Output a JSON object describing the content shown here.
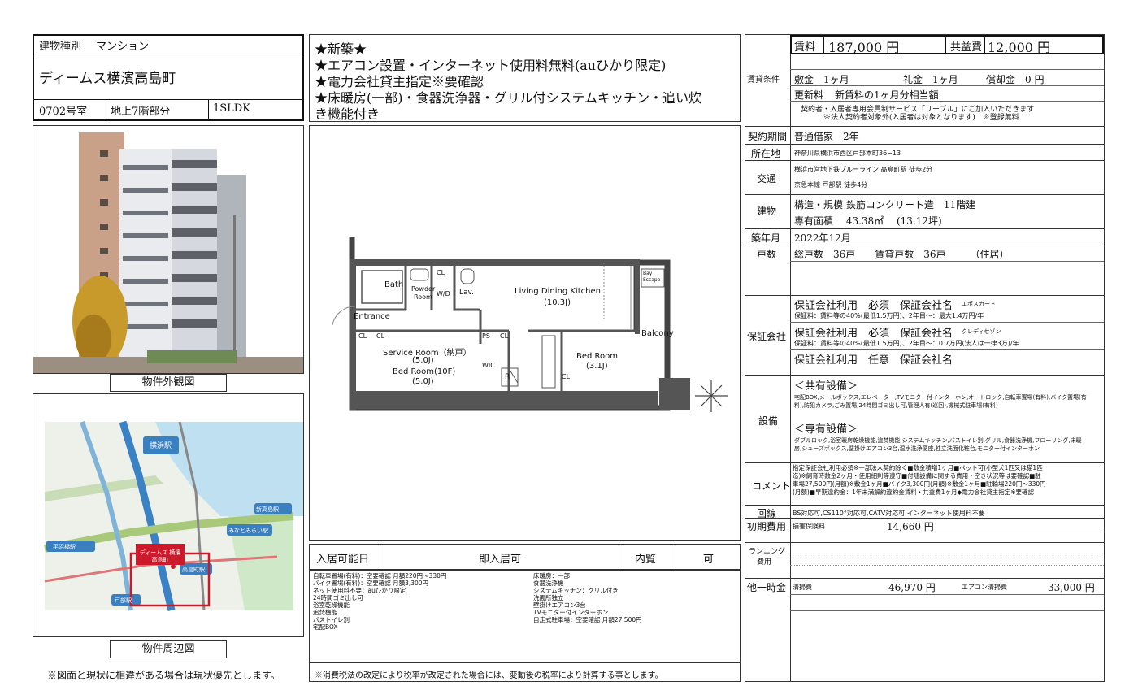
{
  "left": {
    "type_label": "建物種別",
    "type_value": "マンション",
    "building_name": "ディームス横濱高島町",
    "room": "0702号室",
    "floor": "地上7階部分",
    "layout": "1SLDK",
    "photo_caption": "物件外観図",
    "map_caption": "物件周辺図",
    "footnote": "※図面と現状に相違がある場合は現状優先とします。",
    "map_labels": {
      "yokohama": "横浜駅",
      "shintakashima": "新高島駅",
      "minatomirai": "みなとみらい駅",
      "takashimacho": "高島町駅",
      "tobe": "戸部駅",
      "hiranumabashi": "平沼橋駅",
      "property": "ディームス 横濱高島町"
    }
  },
  "headline": {
    "l1": "★新築★",
    "l2": "★エアコン設置・インターネット使用料無料(auひかり限定)",
    "l3": "★電力会社貸主指定※要確認",
    "l4": "★床暖房(一部)・食器洗浄器・グリル付システムキッチン・追い炊",
    "l5": "き機能付き"
  },
  "floorplan": {
    "bath": "Bath",
    "powder1": "Powder",
    "powder2": "Room",
    "wd": "W/D",
    "lav": "Lav.",
    "ldk1": "Living Dining Kitchen",
    "ldk2": "(10.3J)",
    "entrance": "Entrance",
    "service1": "Service Room（納戸）",
    "service2": "(5.0J)",
    "bed10f1": "Bed Room(10F)",
    "bed10f2": "(5.0J)",
    "wic": "WIC",
    "r": "R",
    "bed1": "Bed Room",
    "bed2": "(3.1J)",
    "balcony": "Balcony",
    "cl": "CL",
    "ps": "PS",
    "escape": "Bay Escape"
  },
  "availability": {
    "label": "入居可能日",
    "value": "即入居可",
    "view_label": "内覧",
    "view_value": "可"
  },
  "equipment_left": [
    "自転車置場(有料)：空要確認 月額220円〜330円",
    "バイク置場(有料)：空要確認 月額3,300円",
    "ネット使用料不要：auひかり限定",
    "24時間ゴミ出し可",
    "浴室乾燥機能",
    "追焚機能",
    "バストイレ別",
    "宅配BOX"
  ],
  "equipment_right": [
    "床暖房：一部",
    "食器洗浄機",
    "システムキッチン：グリル付き",
    "洗面所独立",
    "壁掛けエアコン3台",
    "TVモニター付インターホン",
    "自走式駐車場：空要確認 月額27,500円"
  ],
  "tax_note": "※消費税法の改定により税率が改定された場合には、変動後の税率により計算する事とします。",
  "right": {
    "rent_cond_label": "賃貸条件",
    "rent_label": "賃料",
    "rent_value": "187,000 円",
    "common_label": "共益費",
    "common_value": "12,000 円",
    "deposit": "敷金　1ヶ月",
    "key_money": "礼金　1ヶ月",
    "amortization": "償却金　0 円",
    "renewal_label": "更新料",
    "renewal_value": "新賃料の1ヶ月分相当額",
    "service_note1": "契約者・入居者専用会員制サービス「リーブル」にご加入いただきます",
    "service_note2": "※法人契約者対象外(入居者は対象となります)　※登録無料",
    "contract_label": "契約期間",
    "contract_value": "普通借家　2年",
    "address_label": "所在地",
    "address_value": "神奈川県横浜市西区戸部本町36−13",
    "transport_label": "交通",
    "transport1": "横浜市営地下鉄ブルーライン 高島町駅 徒歩2分",
    "transport2": "京急本線 戸部駅 徒歩4分",
    "building_label": "建物",
    "structure": "構造・規模 鉄筋コンクリート造　11階建",
    "area": "専有面積　 43.38㎡　 (13.12坪)",
    "built_label": "築年月",
    "built_value": "2022年12月",
    "units_label": "戸数",
    "units_value": "総戸数　36戸　　賃貸戸数　36戸　　　（住居）",
    "guarantee_label": "保証会社",
    "g1": "保証会社利用　必須　保証会社名",
    "g1_name": "エポスカード",
    "g1_note": "保証料：賃料等の40%(最低1.5万円)、2年目〜：最大1.4万円/年",
    "g2": "保証会社利用　必須　保証会社名",
    "g2_name": "クレディセゾン",
    "g2_note": "保証料：賃料等の40%(最低1.5万円)、2年目〜：0.7万円(法人は一律3万)/年",
    "g3": "保証会社利用　任意　保証会社名",
    "facilities_label": "設備",
    "shared_title": "＜共有設備＞",
    "shared_text1": "宅配BOX,メールボックス,エレベーター,TVモニター付インターホン,オートロック,自転車置場(有料),バイク置場(有",
    "shared_text2": "料),防犯カメラ,ごみ置場,24時間ゴミ出し可,管理人有(巡回),機械式駐車場(有料)",
    "private_title": "＜専有設備＞",
    "private_text1": "ダブルロック,浴室暖房乾燥機能,追焚機能,システムキッチン,バストイレ別,グリル,食器洗浄機,フローリング,床暖",
    "private_text2": "房,シューズボックス,壁掛けエアコン3台,温水洗浄便座,独立洗面化粧台,モニター付インターホン",
    "comment_label": "コメント",
    "comment1": "指定保証会社利用必須※一部法人契約除く■敷金積増1ヶ月■ペット可(小型犬1匹又は猫1匹",
    "comment2": "迄)※飼育時敷金2ヶ月・使用細則等遵守■付随設備に関する費用・空き状況等は要確認■駐",
    "comment3": "車場27,500円(月額)※敷金1ヶ月■バイク3,300円(月額)※敷金1ヶ月■駐輪場220円〜330円",
    "comment4": "(月額)■早期違約金：1年未満解約違約金賃料・共益費1ヶ月◆電力会社貸主指定※要確認",
    "line_label": "回線",
    "line_value": "BS対応可,CS110°対応可,CATV対応可,インターネット使用料不要",
    "initial_label": "初期費用",
    "initial_item": "損害保険料",
    "initial_value": "14,660 円",
    "running_label1": "ランニング",
    "running_label2": "費用",
    "other_label": "他一時金",
    "cleaning_label": "清掃費",
    "cleaning_value": "46,970 円",
    "ac_label": "エアコン清掃費",
    "ac_value": "33,000 円"
  }
}
